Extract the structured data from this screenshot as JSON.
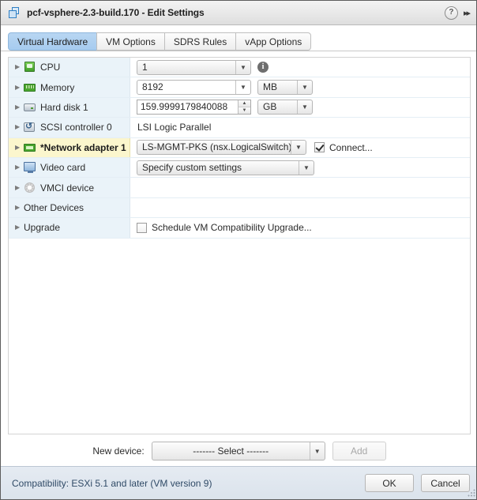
{
  "window": {
    "title": "pcf-vsphere-2.3-build.170 - Edit Settings",
    "icon": "vm-icon",
    "help_icon": "?",
    "expand_icon": "▸▸"
  },
  "tabs": [
    {
      "label": "Virtual Hardware",
      "active": true
    },
    {
      "label": "VM Options",
      "active": false
    },
    {
      "label": "SDRS Rules",
      "active": false
    },
    {
      "label": "vApp Options",
      "active": false
    }
  ],
  "devices": [
    {
      "label": "CPU",
      "icon": "cpu-icon",
      "control": "combo",
      "value": "1",
      "info_icon": "i",
      "highlight": false
    },
    {
      "label": "Memory",
      "icon": "memory-icon",
      "control": "combo-unit",
      "value": "8192",
      "unit": "MB",
      "highlight": false
    },
    {
      "label": "Hard disk 1",
      "icon": "harddisk-icon",
      "control": "spinner-unit",
      "value": "159.9999179840088",
      "unit": "GB",
      "highlight": false
    },
    {
      "label": "SCSI controller 0",
      "icon": "scsi-controller-icon",
      "control": "text",
      "value": "LSI Logic Parallel",
      "highlight": false
    },
    {
      "label": "*Network adapter 1",
      "icon": "network-adapter-icon",
      "control": "combo-checkbox",
      "value": "LS-MGMT-PKS (nsx.LogicalSwitch)",
      "checkbox_label": "Connect...",
      "checkbox_checked": true,
      "highlight": true
    },
    {
      "label": "Video card",
      "icon": "video-card-icon",
      "control": "combo",
      "value": "Specify custom settings",
      "highlight": false
    },
    {
      "label": "VMCI device",
      "icon": "vmci-device-icon",
      "control": "none",
      "value": "",
      "highlight": false
    },
    {
      "label": "Other Devices",
      "icon": "none",
      "control": "none",
      "value": "",
      "highlight": false
    },
    {
      "label": "Upgrade",
      "icon": "none",
      "control": "checkbox",
      "checkbox_label": "Schedule VM Compatibility Upgrade...",
      "checkbox_checked": false,
      "highlight": false
    }
  ],
  "new_device": {
    "label": "New device:",
    "selected": "------- Select -------",
    "add_label": "Add",
    "add_disabled": true
  },
  "footer": {
    "compatibility": "Compatibility: ESXi 5.1 and later (VM version 9)",
    "ok_label": "OK",
    "cancel_label": "Cancel"
  },
  "colors": {
    "accent": "#a6cbef",
    "highlight_row": "#fbf6cd",
    "label_column": "#eaf3f9",
    "footer": "#dbe3ec"
  }
}
